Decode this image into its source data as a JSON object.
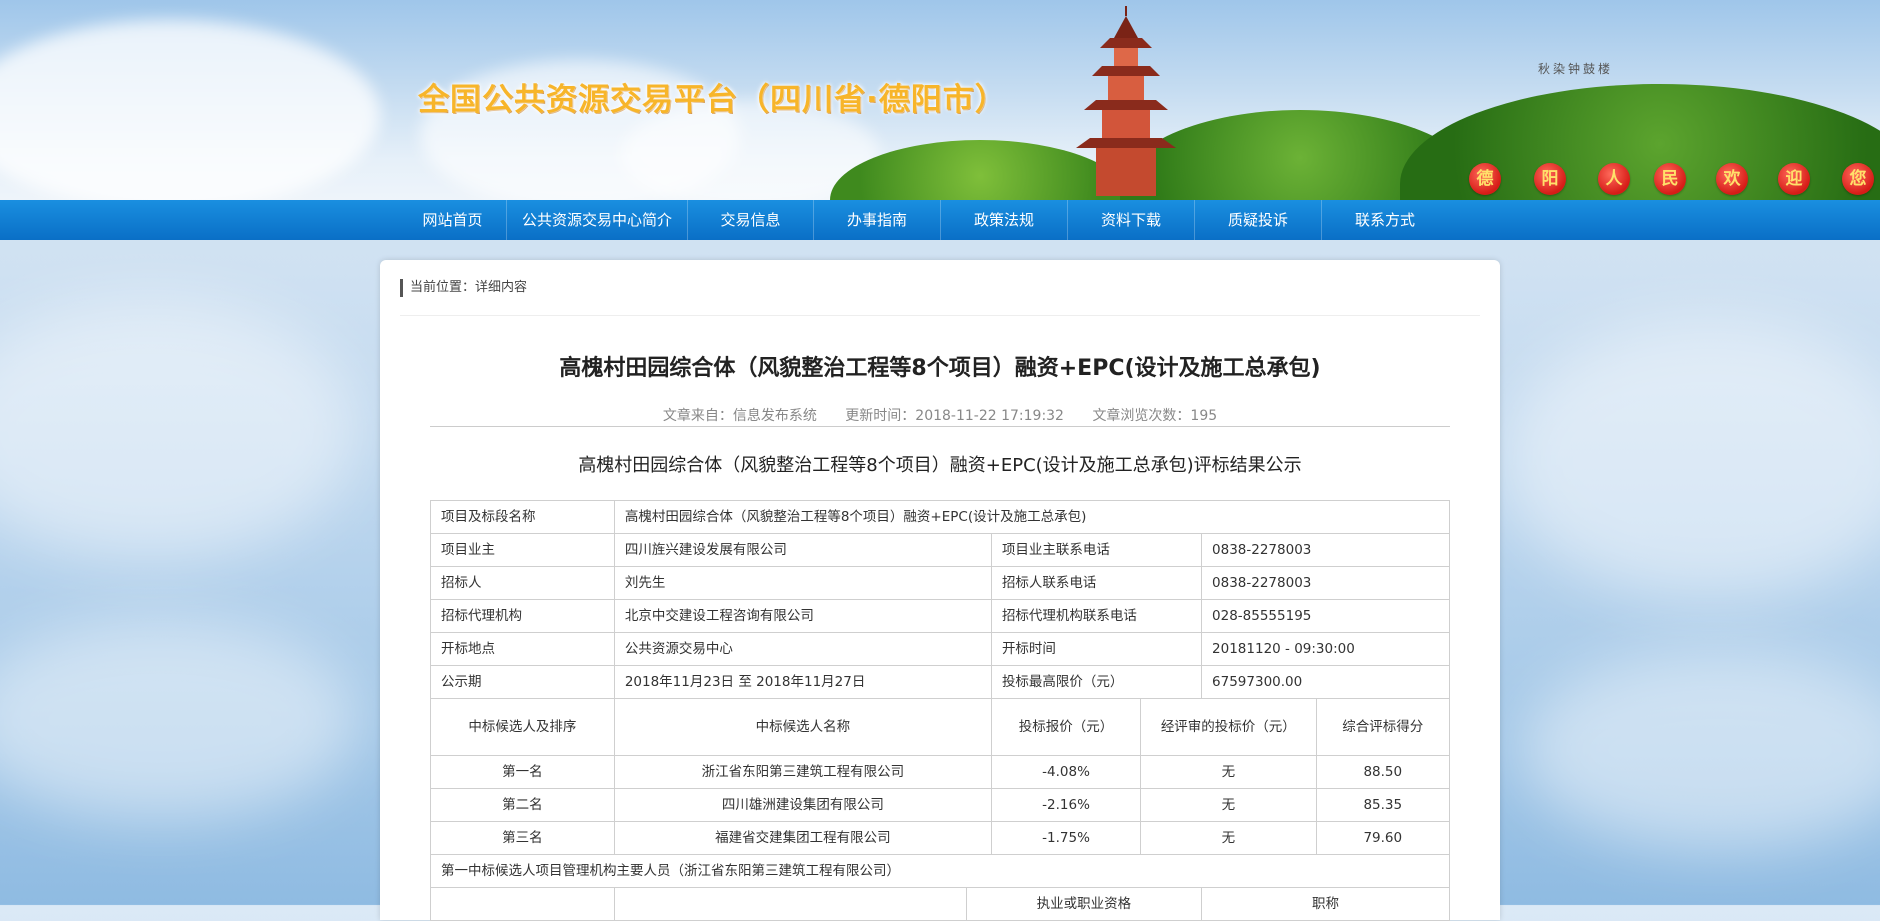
{
  "header": {
    "site_title": "全国公共资源交易平台（四川省·德阳市）",
    "landmark_label": "秋染钟鼓楼",
    "lanterns": [
      "德",
      "阳",
      "人",
      "民",
      "欢",
      "迎",
      "您"
    ]
  },
  "nav": {
    "items": [
      "网站首页",
      "公共资源交易中心简介",
      "交易信息",
      "办事指南",
      "政策法规",
      "资料下载",
      "质疑投诉",
      "联系方式"
    ]
  },
  "breadcrumb": "当前位置：详细内容",
  "article": {
    "title": "高槐村田园综合体（风貌整治工程等8个项目）融资+EPC(设计及施工总承包)",
    "source": "文章来自：信息发布系统",
    "updated": "更新时间：2018-11-22 17:19:32",
    "views": "文章浏览次数：195",
    "subtitle": "高槐村田园综合体（风貌整治工程等8个项目）融资+EPC(设计及施工总承包)评标结果公示"
  },
  "info_table": {
    "project_name_label": "项目及标段名称",
    "project_name_value": "高槐村田园综合体（风貌整治工程等8个项目）融资+EPC(设计及施工总承包)",
    "rows": [
      {
        "l1": "项目业主",
        "v1": "四川旌兴建设发展有限公司",
        "l2": "项目业主联系电话",
        "v2": "0838-2278003"
      },
      {
        "l1": "招标人",
        "v1": "刘先生",
        "l2": "招标人联系电话",
        "v2": "0838-2278003"
      },
      {
        "l1": "招标代理机构",
        "v1": "北京中交建设工程咨询有限公司",
        "l2": "招标代理机构联系电话",
        "v2": "028-85555195"
      },
      {
        "l1": "开标地点",
        "v1": "公共资源交易中心",
        "l2": "开标时间",
        "v2": "20181120 - 09:30:00"
      },
      {
        "l1": "公示期",
        "v1": "2018年11月23日 至 2018年11月27日",
        "l2": "投标最高限价（元）",
        "v2": "67597300.00"
      }
    ],
    "candidate_headers": [
      "中标候选人及排序",
      "中标候选人名称",
      "投标报价（元）",
      "经评审的投标价（元）",
      "综合评标得分"
    ],
    "candidates": [
      {
        "rank": "第一名",
        "name": "浙江省东阳第三建筑工程有限公司",
        "bid": "-4.08%",
        "reviewed": "无",
        "score": "88.50"
      },
      {
        "rank": "第二名",
        "name": "四川雄洲建设集团有限公司",
        "bid": "-2.16%",
        "reviewed": "无",
        "score": "85.35"
      },
      {
        "rank": "第三名",
        "name": "福建省交建集团工程有限公司",
        "bid": "-1.75%",
        "reviewed": "无",
        "score": "79.60"
      }
    ],
    "personnel_caption": "第一中标候选人项目管理机构主要人员（浙江省东阳第三建筑工程有限公司）",
    "personnel_headers": [
      "执业或职业资格",
      "职称"
    ]
  }
}
